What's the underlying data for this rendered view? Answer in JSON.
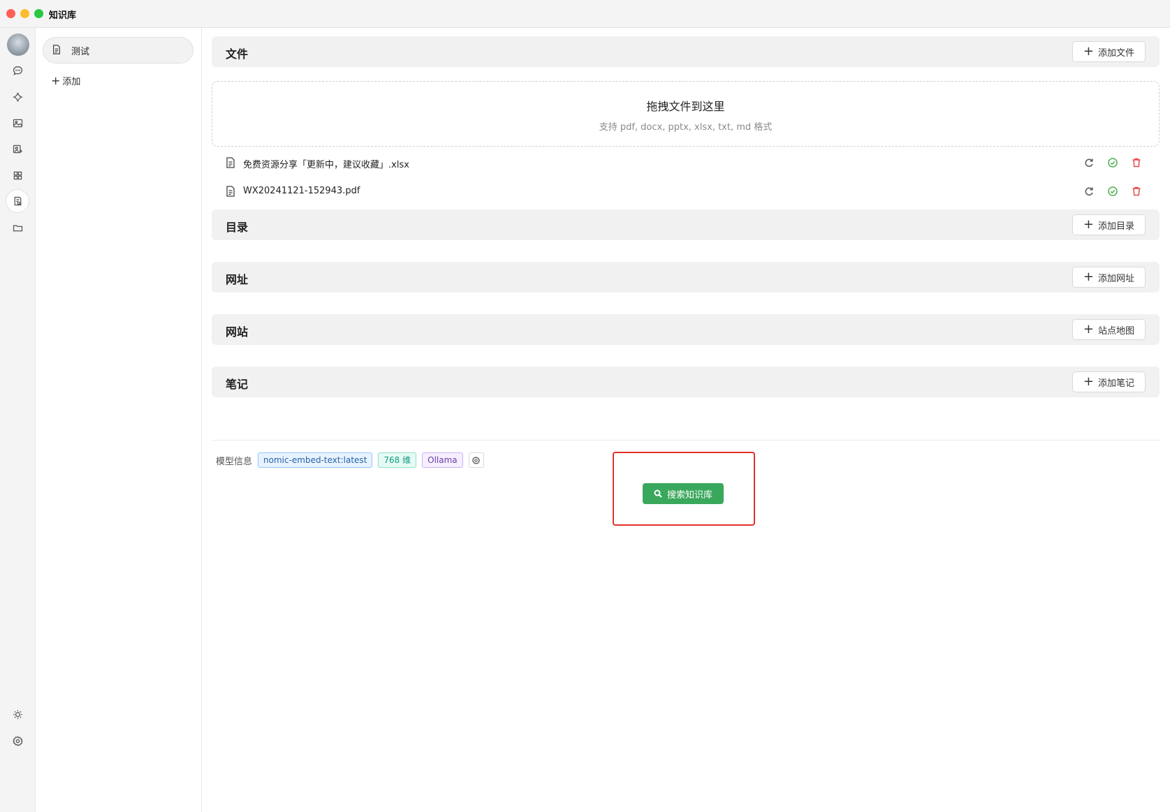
{
  "app": {
    "title": "知识库"
  },
  "rail": {
    "icons": [
      "chat-icon",
      "sparkle-icon",
      "image-icon",
      "image-person-icon",
      "apps-grid-icon",
      "knowledge-icon",
      "folder-icon",
      "sun-icon",
      "settings-icon"
    ],
    "active": "knowledge-icon"
  },
  "kb_list": {
    "items": [
      {
        "label": "测试",
        "selected": true
      }
    ],
    "add_label": "添加"
  },
  "sections": {
    "files": {
      "title": "文件",
      "add_label": "添加文件"
    },
    "directory": {
      "title": "目录",
      "add_label": "添加目录"
    },
    "urls": {
      "title": "网址",
      "add_label": "添加网址"
    },
    "website": {
      "title": "网站",
      "add_label": "站点地图"
    },
    "notes": {
      "title": "笔记",
      "add_label": "添加笔记"
    }
  },
  "dropzone": {
    "title": "拖拽文件到这里",
    "subtitle": "支持 pdf, docx, pptx, xlsx, txt, md 格式"
  },
  "files": [
    {
      "name": "免费资源分享「更新中，建议收藏」.xlsx",
      "status": "done"
    },
    {
      "name": "WX20241121-152943.pdf",
      "status": "done"
    }
  ],
  "model_info": {
    "label": "模型信息",
    "model": "nomic-embed-text:latest",
    "dimensions": "768 维",
    "provider": "Ollama"
  },
  "search_button": {
    "label": "搜索知识库"
  },
  "colors": {
    "accent_green": "#3aa85c",
    "highlight_red": "#e0322a",
    "delete_red": "#e5484d",
    "ok_green": "#4caf50"
  }
}
